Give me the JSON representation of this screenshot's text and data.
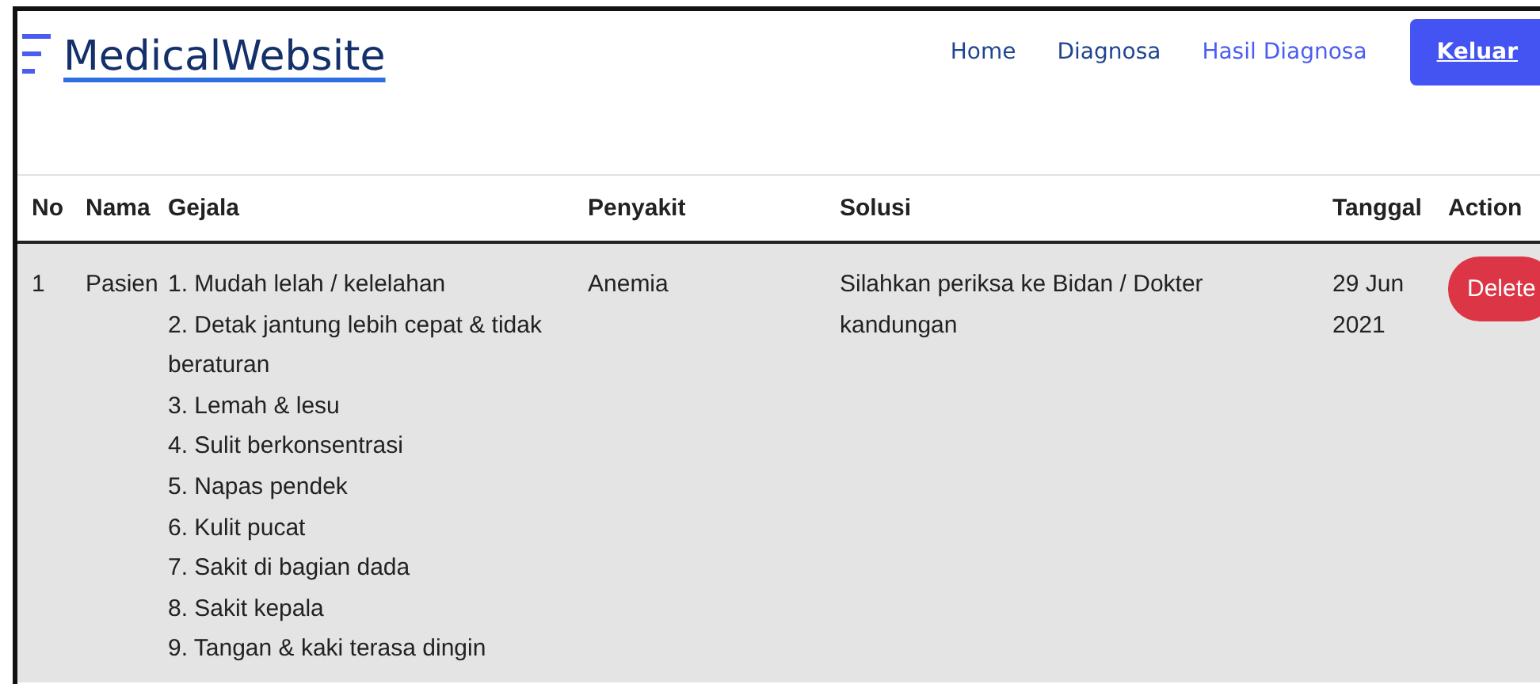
{
  "brand": {
    "title": "MedicalWebsite"
  },
  "nav": [
    {
      "label": "Home",
      "selected": false
    },
    {
      "label": "Diagnosa",
      "selected": false
    },
    {
      "label": "Hasil Diagnosa",
      "selected": true
    }
  ],
  "logout_button": "Keluar",
  "table": {
    "columns": [
      "No",
      "Nama",
      "Gejala",
      "Penyakit",
      "Solusi",
      "Tanggal",
      "Action"
    ],
    "rows": [
      {
        "no": "1",
        "nama": "Pasien",
        "gejala": [
          "1. Mudah lelah / kelelahan",
          "2. Detak jantung lebih cepat & tidak beraturan",
          "3. Lemah & lesu",
          "4. Sulit berkonsentrasi",
          "5. Napas pendek",
          "6. Kulit pucat",
          "7. Sakit di bagian dada",
          "8. Sakit kepala",
          "9. Tangan & kaki terasa dingin"
        ],
        "penyakit": "Anemia",
        "solusi": "Silahkan periksa ke Bidan / Dokter kandungan",
        "tanggal": "29 Jun 2021",
        "action": "Delete"
      }
    ]
  }
}
